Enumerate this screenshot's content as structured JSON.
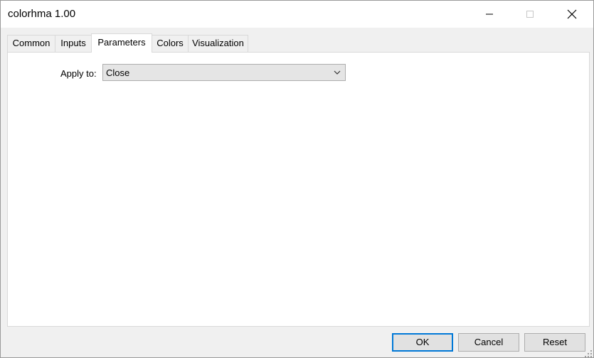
{
  "window": {
    "title": "colorhma 1.00"
  },
  "titlebar_buttons": {
    "minimize_icon": "minimize-icon",
    "maximize_icon": "maximize-icon",
    "close_icon": "close-icon"
  },
  "tabs": [
    {
      "label": "Common",
      "active": false
    },
    {
      "label": "Inputs",
      "active": false
    },
    {
      "label": "Parameters",
      "active": true
    },
    {
      "label": "Colors",
      "active": false
    },
    {
      "label": "Visualization",
      "active": false
    }
  ],
  "parameters": {
    "apply_to_label": "Apply to:",
    "apply_to_value": "Close"
  },
  "footer": {
    "ok_label": "OK",
    "cancel_label": "Cancel",
    "reset_label": "Reset"
  },
  "colors": {
    "focus_border": "#0078d7",
    "button_face": "#e1e1e1"
  }
}
